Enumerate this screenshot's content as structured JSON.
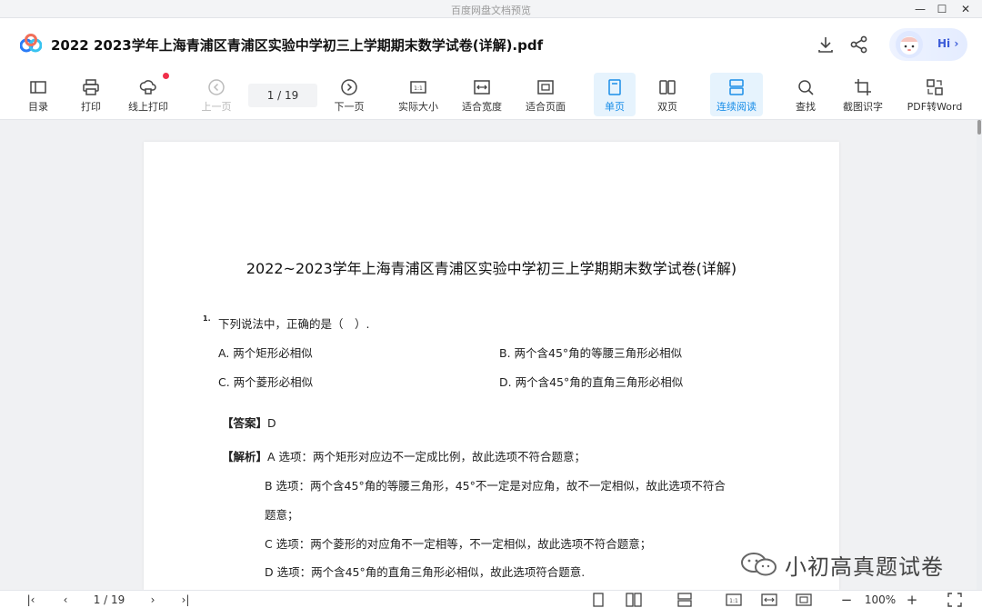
{
  "window": {
    "app_title": "百度网盘文档预览",
    "controls": {
      "minimize": "—",
      "maximize": "☐",
      "close": "✕"
    }
  },
  "file": {
    "name": "2022 2023学年上海青浦区青浦区实验中学初三上学期期末数学试卷(详解).pdf",
    "hi_label": "Hi ›"
  },
  "toolbar": {
    "toc": "目录",
    "print": "打印",
    "online_print": "线上打印",
    "prev_page": "上一页",
    "page_indicator": "1 / 19",
    "next_page": "下一页",
    "actual_size": "实际大小",
    "fit_width": "适合宽度",
    "fit_page": "适合页面",
    "single_page": "单页",
    "double_page": "双页",
    "continuous": "连续阅读",
    "find": "查找",
    "screenshot_ocr": "截图识字",
    "pdf_to_word": "PDF转Word"
  },
  "document": {
    "title": "2022~2023学年上海青浦区青浦区实验中学初三上学期期末数学试卷(详解)",
    "question_number": "1.",
    "question_text": "下列说法中，正确的是（　）.",
    "options": {
      "a": "A. 两个矩形必相似",
      "b": "B. 两个含45°角的等腰三角形必相似",
      "c": "C. 两个菱形必相似",
      "d": "D. 两个含45°角的直角三角形必相似"
    },
    "answer_label": "【答案】",
    "answer_value": "D",
    "analysis_label": "【解析】",
    "analysis_lines": [
      "A 选项：两个矩形对应边不一定成比例，故此选项不符合题意；",
      "B 选项：两个含45°角的等腰三角形，45°不一定是对应角，故不一定相似，故此选项不符合",
      "题意；",
      "C 选项：两个菱形的对应角不一定相等，不一定相似，故此选项不符合题意；",
      "D 选项：两个含45°角的直角三角形必相似，故此选项符合题意."
    ]
  },
  "watermark": {
    "text": "小初高真题试卷"
  },
  "statusbar": {
    "first": "|‹",
    "prev": "‹",
    "page_indicator": "1 / 19",
    "next": "›",
    "last": "›|",
    "zoom_out": "−",
    "zoom_level": "100%",
    "zoom_in": "+"
  },
  "colors": {
    "accent": "#1a8ee8",
    "active_bg": "#e6f3fd",
    "notify_dot": "#f0304a"
  }
}
